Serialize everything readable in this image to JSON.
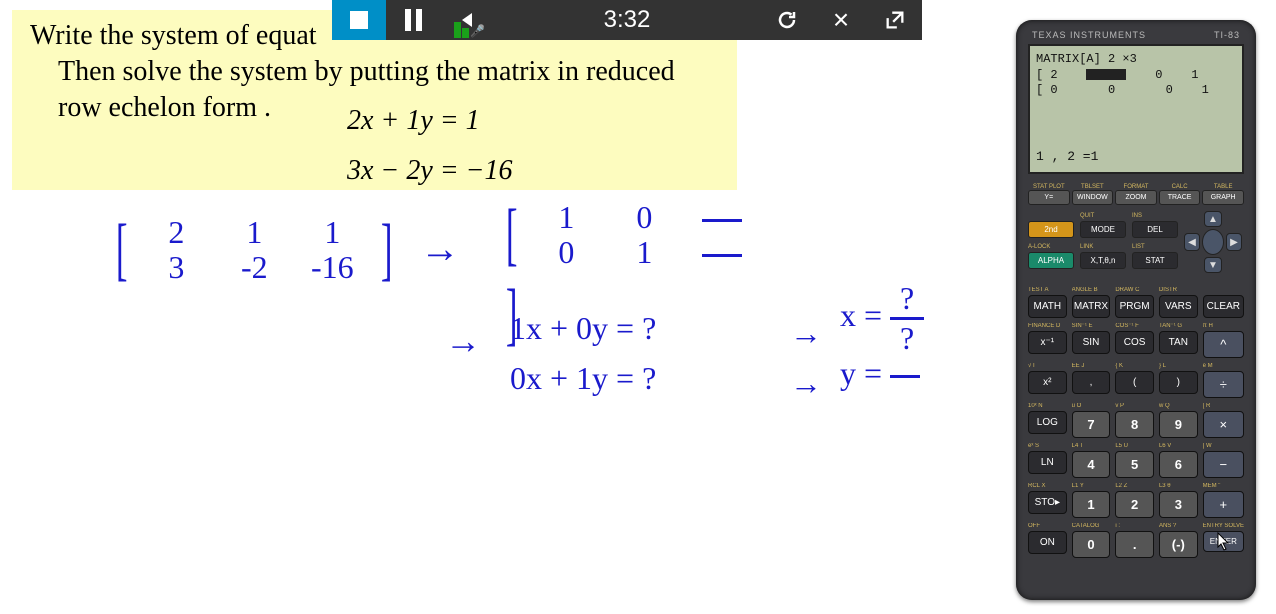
{
  "problem": {
    "line1": "Write the system of equat",
    "line2": "Then solve the system by putting the matrix in reduced",
    "line3": "row echelon form .",
    "eq1": "2x + 1y = 1",
    "eq2": "3x − 2y = −16"
  },
  "handwriting": {
    "matrix1": {
      "r1": [
        "2",
        "1",
        "1"
      ],
      "r2": [
        "3",
        "-2",
        "-16"
      ]
    },
    "matrix2": {
      "r1": [
        "1",
        "0",
        "—"
      ],
      "r2": [
        "0",
        "1",
        "—"
      ]
    },
    "eqrow1": "1x  + 0y = ?",
    "eqrow2": "0x  + 1y = ?",
    "xeq_lhs": "x =",
    "yeq_lhs": "y =",
    "qmark": "?",
    "arrow": "→"
  },
  "player": {
    "time": "3:32"
  },
  "calc": {
    "brand_left": "TEXAS INSTRUMENTS",
    "brand_right": "TI-83",
    "screen_line1": "MATRIX[A] 2 ×3",
    "screen_row1": [
      "[ 2",
      "0",
      "0",
      "1"
    ],
    "screen_row2": [
      "[ 0",
      "0",
      "0",
      "1"
    ],
    "screen_bottom": "1 , 2 =1",
    "toprow_ylabels": [
      "STAT PLOT",
      "TBLSET",
      "FORMAT",
      "CALC",
      "TABLE"
    ],
    "toprow_labels": [
      "Y=",
      "WINDOW",
      "ZOOM",
      "TRACE",
      "GRAPH"
    ],
    "side_ylabels": [
      "",
      "QUIT",
      "INS",
      "A-LOCK",
      "LINK",
      "LIST"
    ],
    "side_labels": [
      "2nd",
      "MODE",
      "DEL",
      "ALPHA",
      "X,T,θ,n",
      "STAT"
    ],
    "grid": [
      {
        "y": "TEST  A",
        "l": "MATH"
      },
      {
        "y": "ANGLE B",
        "l": "MATRX"
      },
      {
        "y": "DRAW C",
        "l": "PRGM"
      },
      {
        "y": "DISTR",
        "l": "VARS"
      },
      {
        "y": "",
        "l": "CLEAR"
      },
      {
        "y": "FINANCE D",
        "l": "x⁻¹"
      },
      {
        "y": "SIN⁻¹ E",
        "l": "SIN"
      },
      {
        "y": "COS⁻¹ F",
        "l": "COS"
      },
      {
        "y": "TAN⁻¹ G",
        "l": "TAN"
      },
      {
        "y": "π  H",
        "l": "^",
        "op": true
      },
      {
        "y": "√  I",
        "l": "x²"
      },
      {
        "y": "EE  J",
        "l": ","
      },
      {
        "y": "{  K",
        "l": "("
      },
      {
        "y": "}  L",
        "l": ")"
      },
      {
        "y": "e  M",
        "l": "÷",
        "op": true
      },
      {
        "y": "10ˣ  N",
        "l": "LOG"
      },
      {
        "y": "u  O",
        "l": "7",
        "num": true
      },
      {
        "y": "v  P",
        "l": "8",
        "num": true
      },
      {
        "y": "w  Q",
        "l": "9",
        "num": true
      },
      {
        "y": "[  R",
        "l": "×",
        "op": true
      },
      {
        "y": "eˣ  S",
        "l": "LN"
      },
      {
        "y": "L4  T",
        "l": "4",
        "num": true
      },
      {
        "y": "L5  U",
        "l": "5",
        "num": true
      },
      {
        "y": "L6  V",
        "l": "6",
        "num": true
      },
      {
        "y": "]  W",
        "l": "−",
        "op": true
      },
      {
        "y": "RCL  X",
        "l": "STO▸"
      },
      {
        "y": "L1  Y",
        "l": "1",
        "num": true
      },
      {
        "y": "L2  Z",
        "l": "2",
        "num": true
      },
      {
        "y": "L3  θ",
        "l": "3",
        "num": true
      },
      {
        "y": "MEM \"",
        "l": "+",
        "op": true
      },
      {
        "y": "OFF",
        "l": "ON"
      },
      {
        "y": "CATALOG",
        "l": "0",
        "num": true
      },
      {
        "y": "i  :",
        "l": ".",
        "num": true
      },
      {
        "y": "ANS  ?",
        "l": "(-)",
        "num": true
      },
      {
        "y": "ENTRY SOLVE",
        "l": "ENTER",
        "enter": true,
        "op": true
      }
    ]
  }
}
